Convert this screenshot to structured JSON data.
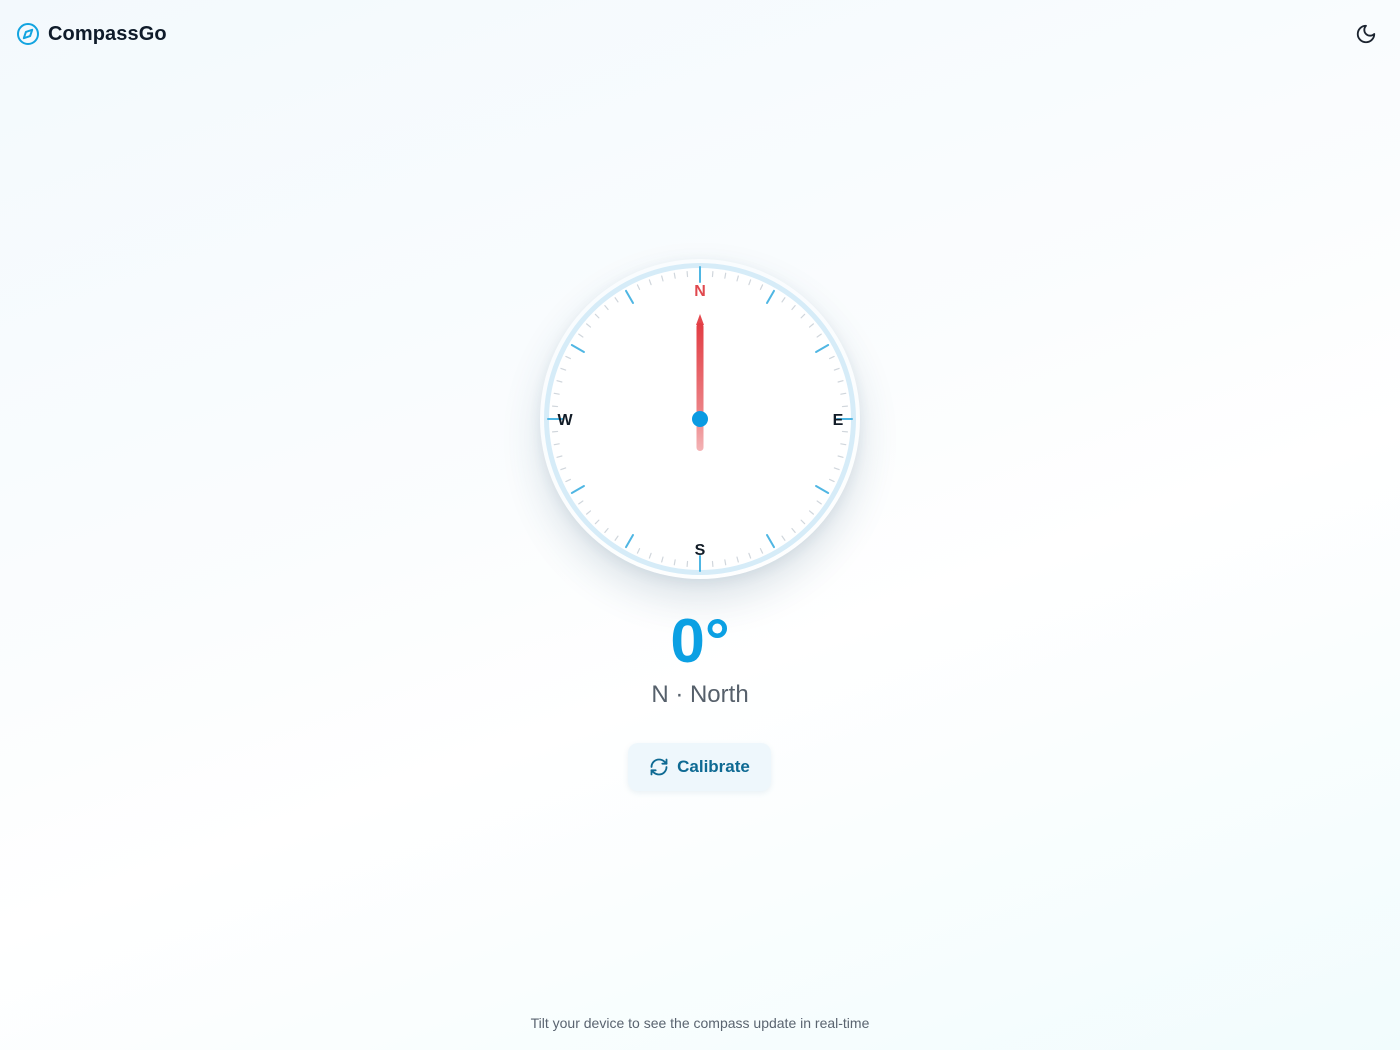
{
  "app": {
    "name": "CompassGo",
    "logo_icon": "compass-icon",
    "theme_toggle_icon": "moon-icon"
  },
  "compass": {
    "cardinals": {
      "north": "N",
      "east": "E",
      "south": "S",
      "west": "W"
    },
    "needle_heading_deg": 0,
    "colors": {
      "ring": "#d6ecf8",
      "major_tick": "#4fb6e3",
      "minor_tick": "#d0d6dc",
      "north_label": "#e0484e",
      "needle": "#e4474d",
      "center_dot": "#0b9be2"
    }
  },
  "reading": {
    "heading": "0°",
    "direction": "N · North"
  },
  "calibrate": {
    "label": "Calibrate",
    "icon": "refresh-icon"
  },
  "footer": {
    "hint": "Tilt your device to see the compass update in real-time"
  },
  "colors": {
    "accent": "#0ba0e3",
    "text_dark": "#0f1b2a"
  }
}
